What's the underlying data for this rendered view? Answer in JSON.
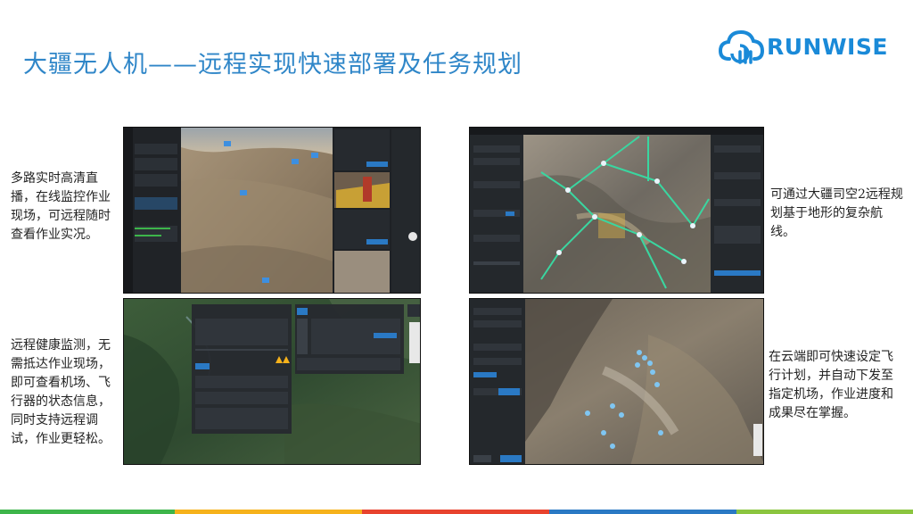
{
  "title": "大疆无人机——远程实现快速部署及任务规划",
  "logo": {
    "text": "RUNWISE",
    "color": "#1a8ad8"
  },
  "captions": {
    "top_left": "多路实时高清直播，在线监控作业现场，可远程随时查看作业实况。",
    "bottom_left": "远程健康监测，无需抵达作业现场，即可查看机场、飞行器的状态信息，同时支持远程调试，作业更轻松。",
    "top_right": "可通过大疆司空2远程规划基于地形的复杂航线。",
    "bottom_right": "在云端即可快速设定飞行计划，并自动下发至指定机场，作业进度和成果尽在掌握。"
  },
  "colors": {
    "title": "#2f86c8",
    "footer": [
      "#3db54a",
      "#f6b21b",
      "#e8432e",
      "#2a79c4",
      "#8bc53f"
    ]
  }
}
